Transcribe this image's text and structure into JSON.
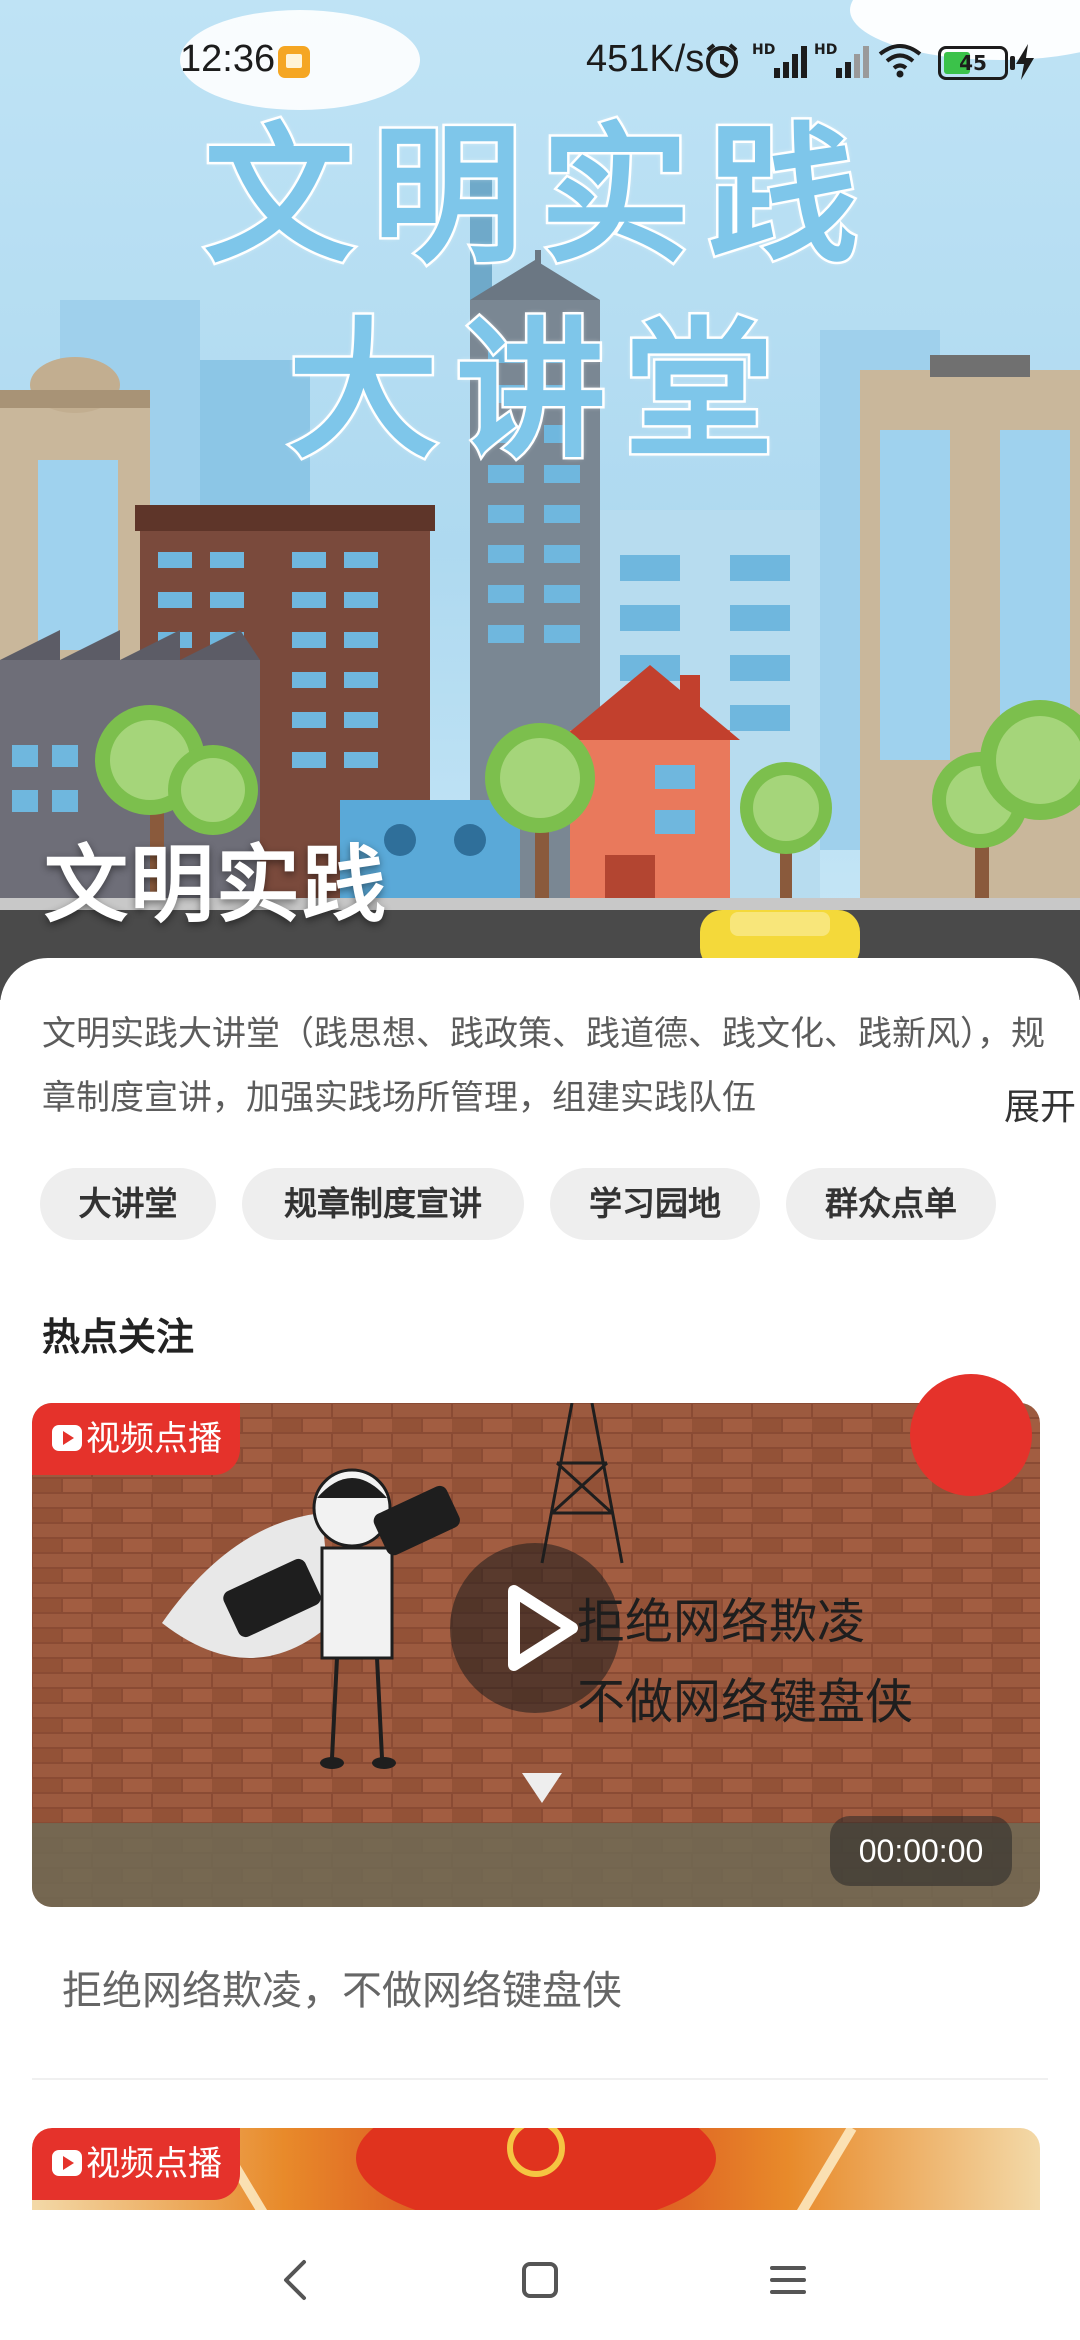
{
  "status_bar": {
    "time": "12:36",
    "net_speed": "451K/s",
    "battery_level": "45",
    "battery_fraction": 0.45,
    "icons": [
      "notification-icon",
      "alarm-icon",
      "hd-signal-icon",
      "hd-signal-icon",
      "wifi-icon",
      "battery-icon",
      "charging-icon"
    ]
  },
  "hero": {
    "title_line_1": "文明实践",
    "title_line_2": "大讲堂",
    "overlay_title": "文明实践"
  },
  "content": {
    "description": "文明实践大讲堂（践思想、践政策、践道德、践文化、践新风），规章制度宣讲，加强实践场所管理，组建实践队伍",
    "expand_label": "展开",
    "tags": [
      "大讲堂",
      "规章制度宣讲",
      "学习园地",
      "群众点单"
    ],
    "section_title": "热点关注",
    "videos": [
      {
        "badge": "视频点播",
        "thumb_text_1": "拒绝网络欺凌",
        "thumb_text_2": "不做网络键盘侠",
        "duration": "00:00:00",
        "title": "拒绝网络欺凌，不做网络键盘侠"
      },
      {
        "badge": "视频点播"
      }
    ]
  },
  "colors": {
    "accent_red": "#e5322b",
    "hero_title_blue": "#7ec6ea",
    "tag_bg": "#eeeeee"
  }
}
